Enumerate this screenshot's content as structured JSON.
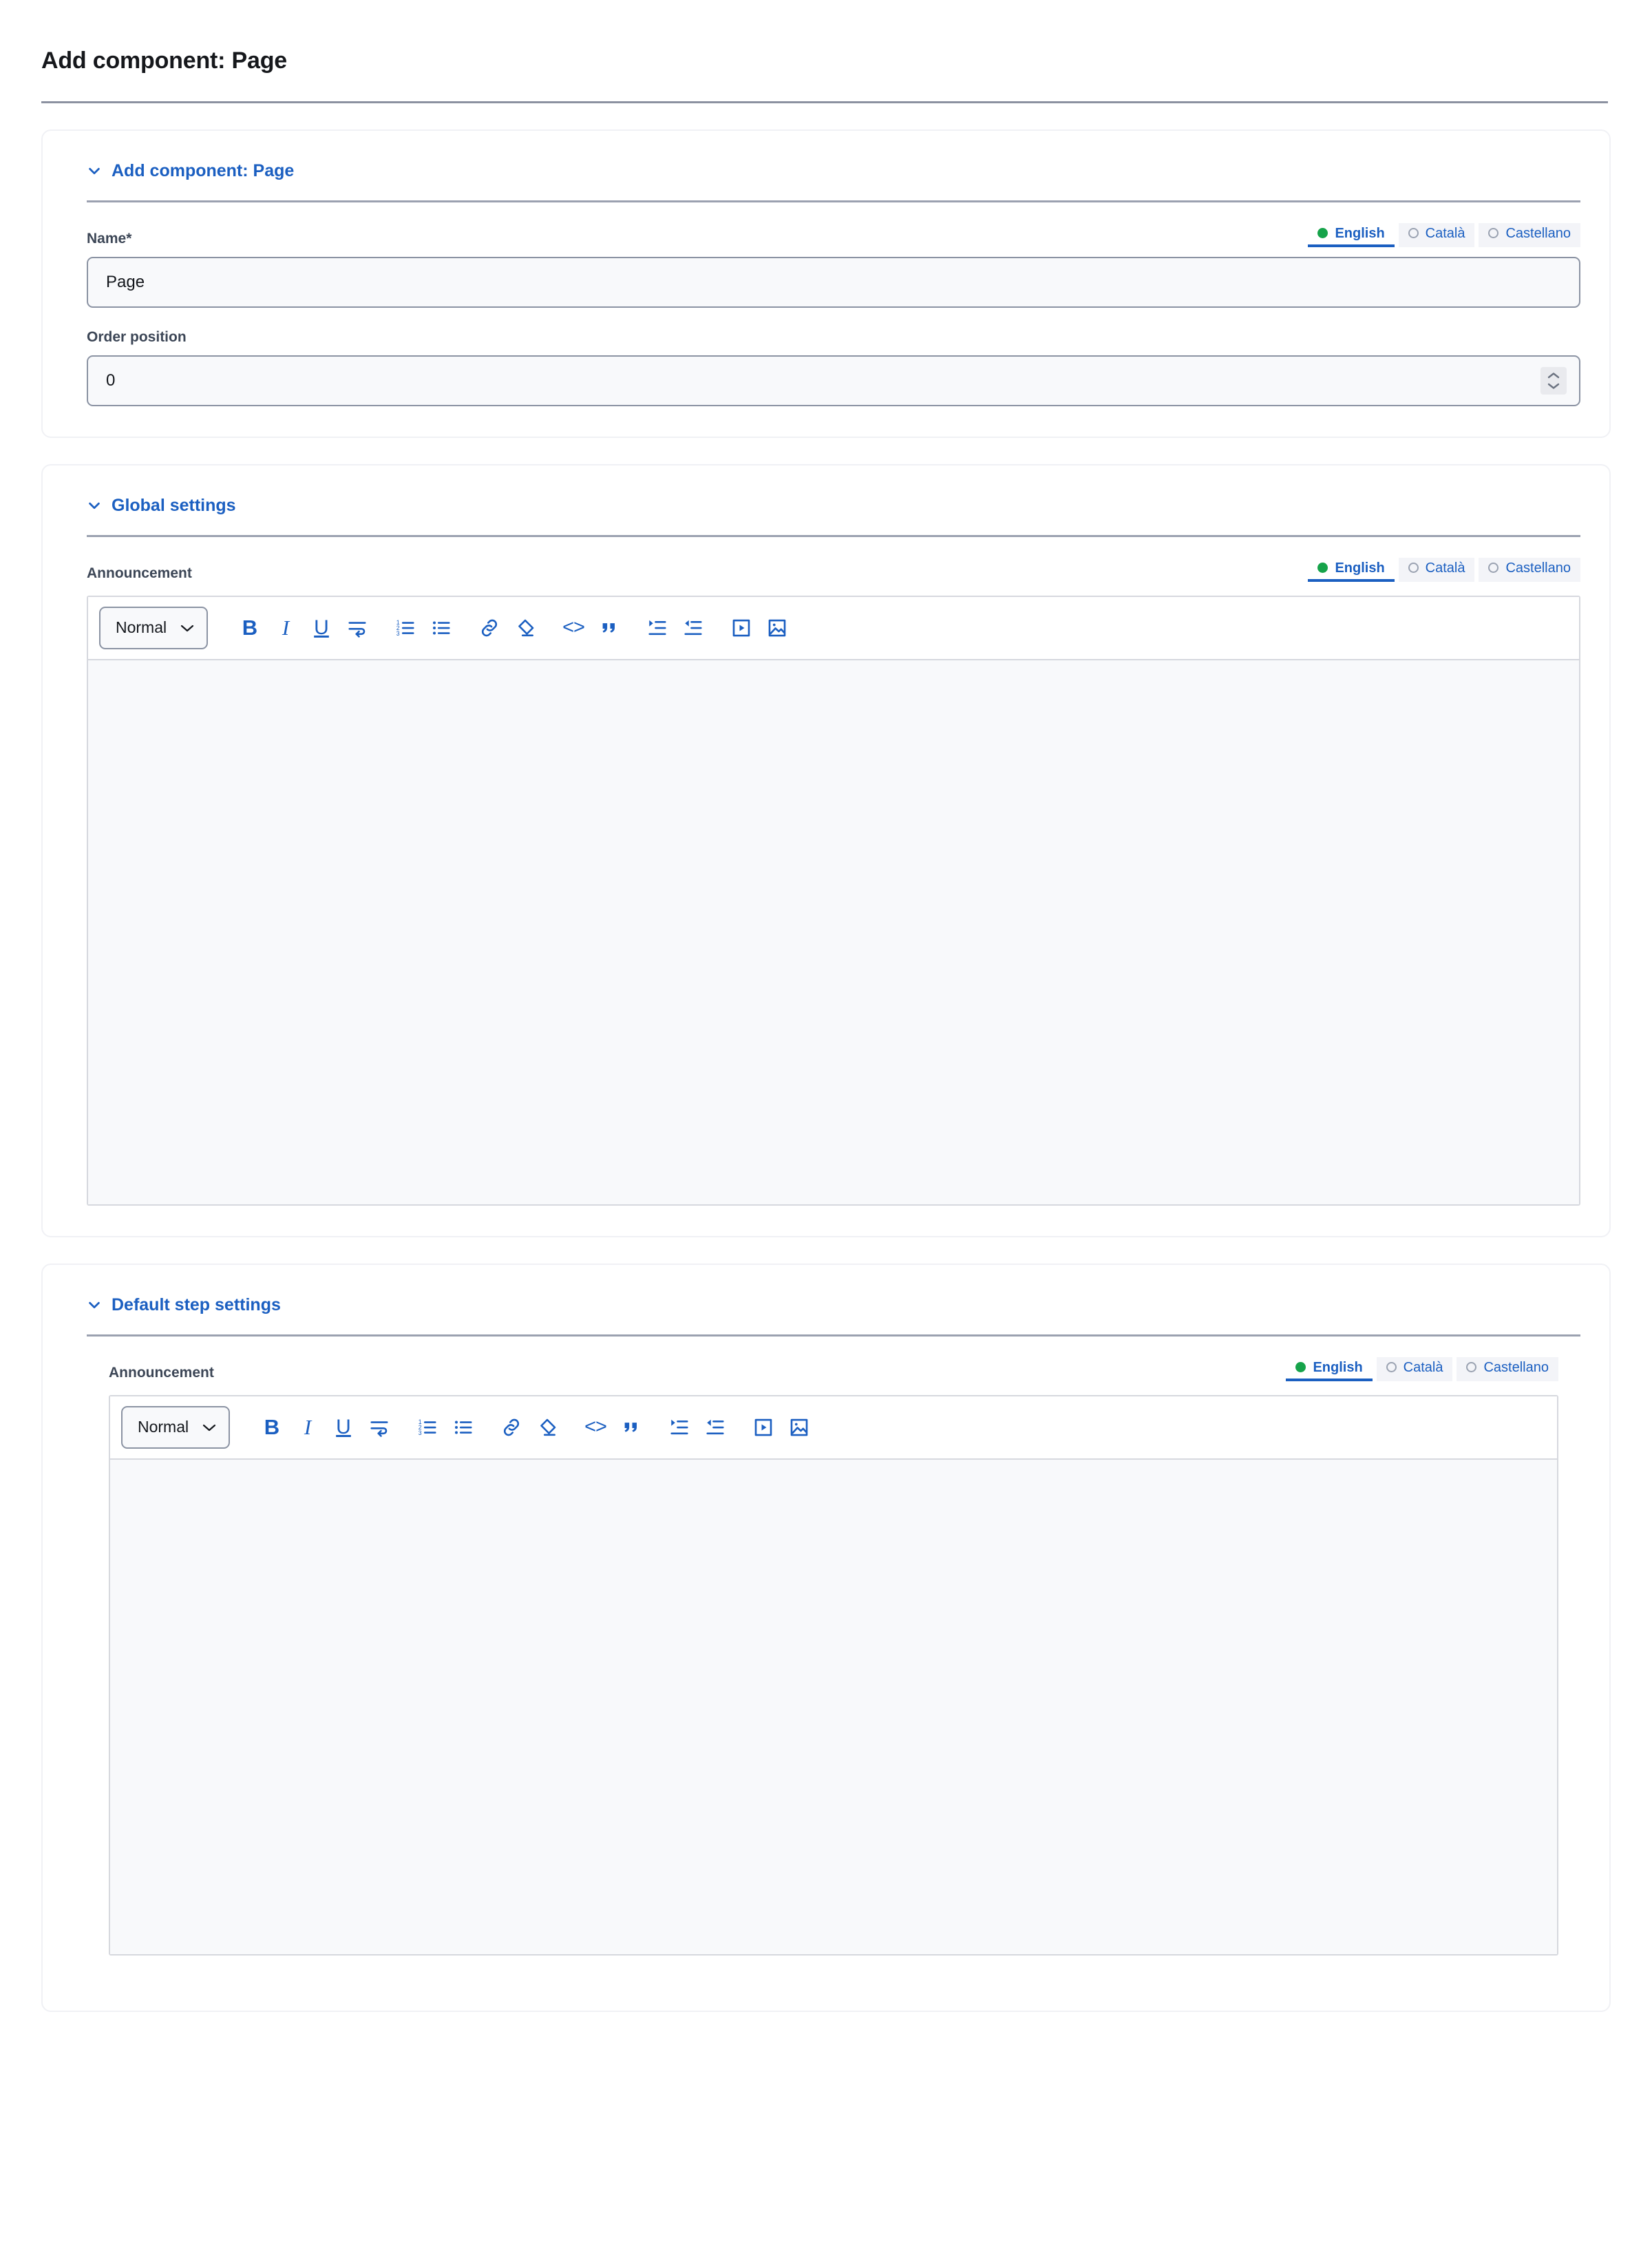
{
  "page": {
    "title": "Add component: Page"
  },
  "languages": [
    {
      "label": "English",
      "selected": true
    },
    {
      "label": "Català",
      "selected": false
    },
    {
      "label": "Castellano",
      "selected": false
    }
  ],
  "editor_toolbar": {
    "format_value": "Normal",
    "format_options": [
      "Normal"
    ],
    "buttons": [
      {
        "name": "bold-icon",
        "label": "B"
      },
      {
        "name": "italic-icon",
        "label": "I"
      },
      {
        "name": "underline-icon",
        "label": "U"
      },
      {
        "name": "line-break-icon",
        "label": ""
      },
      {
        "name": "ordered-list-icon",
        "label": ""
      },
      {
        "name": "bullet-list-icon",
        "label": ""
      },
      {
        "name": "link-icon",
        "label": ""
      },
      {
        "name": "clear-format-eraser-icon",
        "label": ""
      },
      {
        "name": "code-icon",
        "label": "<>"
      },
      {
        "name": "blockquote-icon",
        "label": "“"
      },
      {
        "name": "indent-increase-icon",
        "label": ""
      },
      {
        "name": "indent-decrease-icon",
        "label": ""
      },
      {
        "name": "video-icon",
        "label": ""
      },
      {
        "name": "image-icon",
        "label": ""
      }
    ]
  },
  "sections": {
    "add_component": {
      "heading": "Add component: Page",
      "name_label": "Name*",
      "name_value": "Page",
      "order_label": "Order position",
      "order_value": "0"
    },
    "global_settings": {
      "heading": "Global settings",
      "announcement_label": "Announcement",
      "announcement_value": ""
    },
    "default_step_settings": {
      "heading": "Default step settings",
      "announcement_label": "Announcement",
      "announcement_value": ""
    }
  },
  "colors": {
    "accent": "#1b5fc1",
    "selected_dot": "#16a34a",
    "input_bg": "#f8f9fb",
    "input_border": "#8b93a3",
    "card_border": "#f0f1f5"
  }
}
